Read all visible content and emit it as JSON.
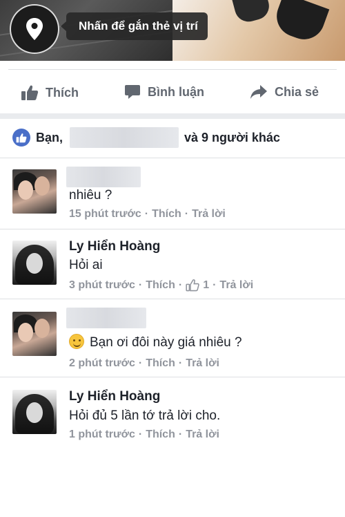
{
  "location": {
    "tooltip": "Nhấn để gắn thẻ vị trí",
    "icon": "location-pin-icon"
  },
  "actions": {
    "like": "Thích",
    "comment": "Bình luận",
    "share": "Chia sẻ"
  },
  "likes": {
    "prefix": "Bạn,",
    "suffix": "và 9 người khác"
  },
  "comments": [
    {
      "author": "",
      "text": "nhiêu ?",
      "time": "15 phút trước",
      "like": "Thích",
      "reply": "Trả lời",
      "like_count": ""
    },
    {
      "author": "Ly Hiển Hoàng",
      "text": "Hỏi ai",
      "time": "3 phút trước",
      "like": "Thích",
      "reply": "Trả lời",
      "like_count": "1"
    },
    {
      "author": "",
      "text": "Bạn ơi đôi này giá nhiêu ?",
      "time": "2 phút trước",
      "like": "Thích",
      "reply": "Trả lời",
      "like_count": "",
      "emoji": "smiling-face-icon"
    },
    {
      "author": "Ly Hiển Hoàng",
      "text": "Hỏi đủ 5 lần tớ trả lời cho.",
      "time": "1 phút trước",
      "like": "Thích",
      "reply": "Trả lời",
      "like_count": ""
    }
  ],
  "colors": {
    "accent": "#4a6fc8",
    "meta_text": "#90949c",
    "action_text": "#616770"
  }
}
